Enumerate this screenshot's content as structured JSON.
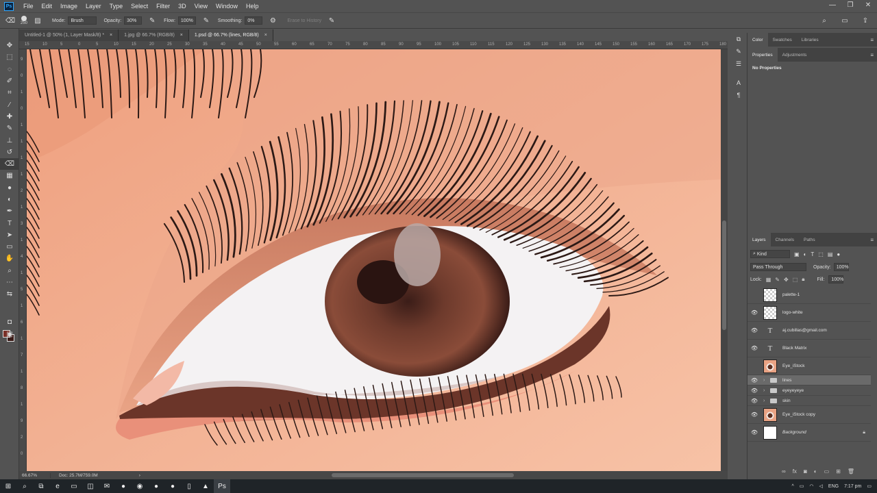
{
  "app": {
    "logo": "Ps"
  },
  "menu": [
    "File",
    "Edit",
    "Image",
    "Layer",
    "Type",
    "Select",
    "Filter",
    "3D",
    "View",
    "Window",
    "Help"
  ],
  "window_controls": [
    "—",
    "❐",
    "✕"
  ],
  "options_bar": {
    "brush_size": "250",
    "mode_label": "Mode:",
    "mode_value": "Brush",
    "opacity_label": "Opacity:",
    "opacity_value": "30%",
    "flow_label": "Flow:",
    "flow_value": "100%",
    "smoothing_label": "Smoothing:",
    "smoothing_value": "0%",
    "erase_history_label": "Erase to History"
  },
  "tabs": [
    {
      "label": "Untitled-1 @ 50% (1, Layer Mask/8) *",
      "close": "×"
    },
    {
      "label": "1.jpg @ 66.7% (RGB/8)",
      "close": "×"
    },
    {
      "label": "1.psd @ 66.7% (lines, RGB/8)",
      "close": "×"
    }
  ],
  "ruler_top": [
    "15",
    "10",
    "5",
    "0",
    "5",
    "10",
    "15",
    "20",
    "25",
    "30",
    "35",
    "40",
    "45",
    "50",
    "55",
    "60",
    "65",
    "70",
    "75",
    "80",
    "85",
    "90",
    "95",
    "100",
    "105",
    "110",
    "115",
    "120",
    "125",
    "130",
    "135",
    "140",
    "145",
    "150",
    "155",
    "160",
    "165",
    "170",
    "175",
    "180",
    "185",
    "190",
    "195",
    "200",
    "205",
    "210",
    "215",
    "220",
    "225",
    "230"
  ],
  "ruler_left": [
    "9",
    "0",
    "1",
    "0",
    "1",
    "1",
    "1",
    "1",
    "2",
    "1",
    "3",
    "1",
    "4",
    "1",
    "5",
    "1",
    "6",
    "1",
    "7",
    "1",
    "8",
    "1",
    "9",
    "2",
    "0"
  ],
  "status": {
    "zoom": "66.67%",
    "doc": "Doc: 25.7M/759.0M",
    "arrow": "›"
  },
  "color_panel_tabs": [
    "Color",
    "Swatches",
    "Libraries"
  ],
  "properties_tabs": [
    "Properties",
    "Adjustments"
  ],
  "properties_text": "No Properties",
  "layers_tabs": [
    "Layers",
    "Channels",
    "Paths"
  ],
  "layers_filter": "Kind",
  "blend_mode": "Pass Through",
  "opacity_label": "Opacity:",
  "opacity_value": "100%",
  "lock_label": "Lock:",
  "fill_label": "Fill:",
  "fill_value": "100%",
  "layers": [
    {
      "name": "palette-1",
      "visible": false,
      "thumb": "chk"
    },
    {
      "name": "logo-white",
      "visible": true,
      "thumb": "chk"
    },
    {
      "name": "aj.cubillas@gmail.com",
      "visible": true,
      "thumb": "txt"
    },
    {
      "name": "Black Matrix",
      "visible": true,
      "thumb": "txt"
    },
    {
      "name": "Eye_iStock",
      "visible": false,
      "thumb": "eyeimg"
    },
    {
      "name": "lines",
      "visible": true,
      "thumb": "folder"
    },
    {
      "name": "eyeyeyeye",
      "visible": true,
      "thumb": "folder"
    },
    {
      "name": "skin",
      "visible": true,
      "thumb": "folder"
    },
    {
      "name": "Eye_iStock copy",
      "visible": true,
      "thumb": "eyeimg"
    },
    {
      "name": "Background",
      "visible": true,
      "thumb": "white"
    }
  ],
  "taskbar": {
    "lang": "ENG",
    "time": "7:17 pm"
  }
}
